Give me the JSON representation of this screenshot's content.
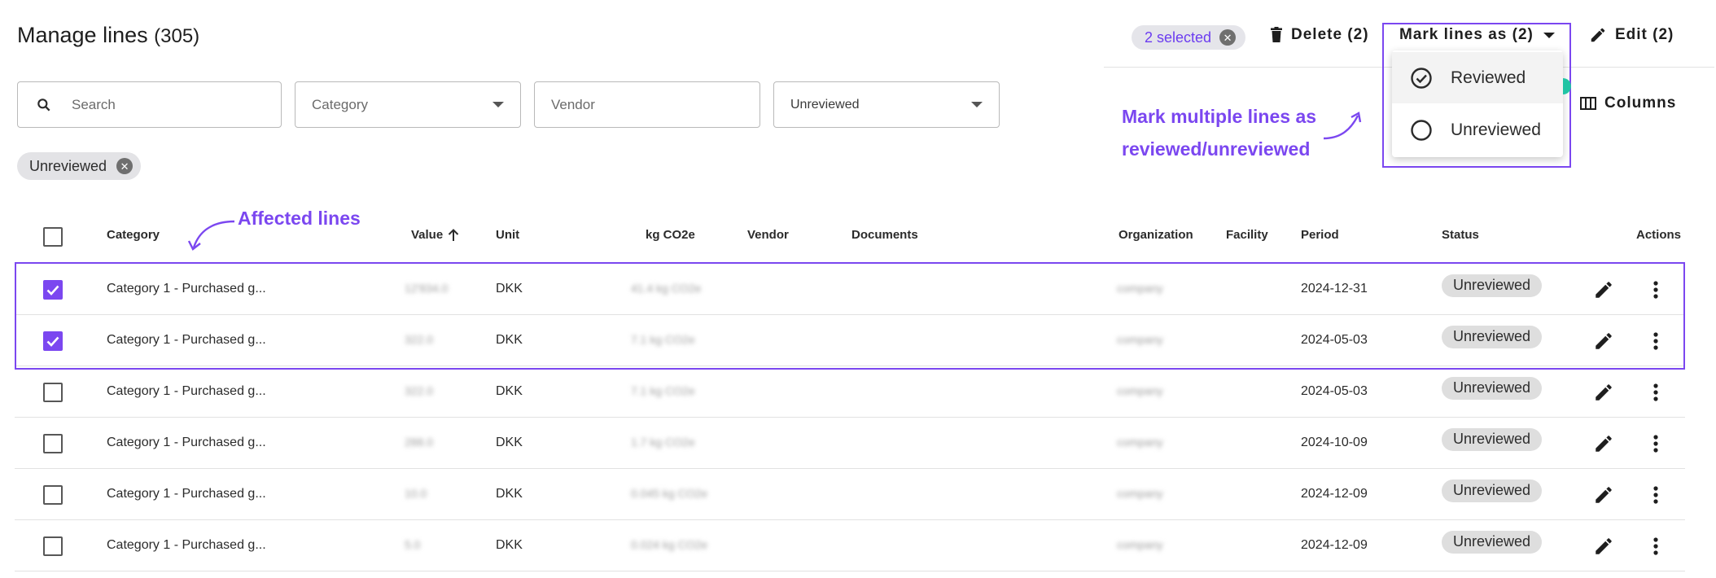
{
  "header": {
    "title": "Manage lines",
    "count": "(305)",
    "selected_chip": "2 selected",
    "delete_label": "Delete (2)",
    "mark_label": "Mark lines as (2)",
    "edit_label": "Edit (2)",
    "columns_label": "Columns"
  },
  "filters": {
    "search_placeholder": "Search",
    "category_placeholder": "Category",
    "vendor_placeholder": "Vendor",
    "review_value": "Unreviewed",
    "active_chip": "Unreviewed"
  },
  "mark_menu": {
    "items": [
      {
        "label": "Reviewed",
        "icon": "check-circle-icon"
      },
      {
        "label": "Unreviewed",
        "icon": "empty-circle-icon"
      }
    ]
  },
  "annotations": {
    "affected_lines": "Affected lines",
    "mark_multiple_1": "Mark multiple lines as",
    "mark_multiple_2": "reviewed/unreviewed"
  },
  "table": {
    "columns": {
      "category": "Category",
      "value": "Value",
      "unit": "Unit",
      "kg": "kg CO2e",
      "vendor": "Vendor",
      "documents": "Documents",
      "organization": "Organization",
      "facility": "Facility",
      "period": "Period",
      "status": "Status",
      "actions": "Actions"
    },
    "rows": [
      {
        "checked": true,
        "category": "Category 1 - Purchased g...",
        "value": "12'834.0",
        "unit": "DKK",
        "kg": "41.4 kg CO2e",
        "organization": "company",
        "period": "2024-12-31",
        "status": "Unreviewed"
      },
      {
        "checked": true,
        "category": "Category 1 - Purchased g...",
        "value": "322.0",
        "unit": "DKK",
        "kg": "7.1 kg CO2e",
        "organization": "company",
        "period": "2024-05-03",
        "status": "Unreviewed"
      },
      {
        "checked": false,
        "category": "Category 1 - Purchased g...",
        "value": "322.0",
        "unit": "DKK",
        "kg": "7.1 kg CO2e",
        "organization": "company",
        "period": "2024-05-03",
        "status": "Unreviewed"
      },
      {
        "checked": false,
        "category": "Category 1 - Purchased g...",
        "value": "288.0",
        "unit": "DKK",
        "kg": "1.7 kg CO2e",
        "organization": "company",
        "period": "2024-10-09",
        "status": "Unreviewed"
      },
      {
        "checked": false,
        "category": "Category 1 - Purchased g...",
        "value": "10.0",
        "unit": "DKK",
        "kg": "0.045 kg CO2e",
        "organization": "company",
        "period": "2024-12-09",
        "status": "Unreviewed"
      },
      {
        "checked": false,
        "category": "Category 1 - Purchased g...",
        "value": "5.0",
        "unit": "DKK",
        "kg": "0.024 kg CO2e",
        "organization": "company",
        "period": "2024-12-09",
        "status": "Unreviewed"
      }
    ]
  },
  "colors": {
    "accent": "#7b47f0",
    "chip_bg": "#e3e3e6",
    "status_bg": "#dedede",
    "teal": "#20c4a4"
  }
}
